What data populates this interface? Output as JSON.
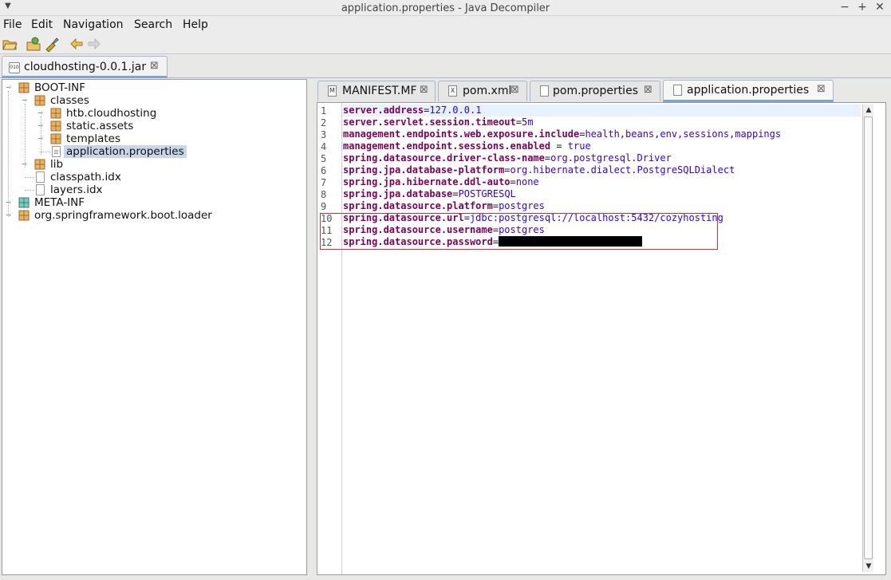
{
  "window": {
    "title": "application.properties - Java Decompiler",
    "minimize": "−",
    "maximize": "+",
    "close": "✕"
  },
  "menu": [
    "File",
    "Edit",
    "Navigation",
    "Search",
    "Help"
  ],
  "jar_tab": {
    "label": "cloudhosting-0.0.1.jar",
    "close": "⊠",
    "icon_text": "010"
  },
  "tree": {
    "nodes": [
      {
        "label": "BOOT-INF"
      },
      {
        "label": "classes"
      },
      {
        "label": "htb.cloudhosting"
      },
      {
        "label": "static.assets"
      },
      {
        "label": "templates"
      },
      {
        "label": "application.properties"
      },
      {
        "label": "lib"
      },
      {
        "label": "classpath.idx"
      },
      {
        "label": "layers.idx"
      },
      {
        "label": "META-INF"
      },
      {
        "label": "org.springframework.boot.loader"
      }
    ]
  },
  "editor_tabs": [
    {
      "label": "MANIFEST.MF",
      "icon": "M"
    },
    {
      "label": "pom.xml",
      "icon": "X"
    },
    {
      "label": "pom.properties",
      "icon": ""
    },
    {
      "label": "application.properties",
      "icon": ""
    }
  ],
  "tab_close": "⊠",
  "code": [
    {
      "n": "1",
      "key": "server.address",
      "sep": "=",
      "val": "127.0.0.1"
    },
    {
      "n": "2",
      "key": "server.servlet.session.timeout",
      "sep": "=",
      "val": "5m"
    },
    {
      "n": "3",
      "key": "management.endpoints.web.exposure.include",
      "sep": "=",
      "val": "health,beans,env,sessions,mappings"
    },
    {
      "n": "4",
      "key": "management.endpoint.sessions.enabled",
      "sep": " = ",
      "val": "true"
    },
    {
      "n": "5",
      "key": "spring.datasource.driver-class-name",
      "sep": "=",
      "val": "org.postgresql.Driver"
    },
    {
      "n": "6",
      "key": "spring.jpa.database-platform",
      "sep": "=",
      "val": "org.hibernate.dialect.PostgreSQLDialect"
    },
    {
      "n": "7",
      "key": "spring.jpa.hibernate.ddl-auto",
      "sep": "=",
      "val": "none"
    },
    {
      "n": "8",
      "key": "spring.jpa.database",
      "sep": "=",
      "val": "POSTGRESQL"
    },
    {
      "n": "9",
      "key": "spring.datasource.platform",
      "sep": "=",
      "val": "postgres"
    },
    {
      "n": "10",
      "key": "spring.datasource.url",
      "sep": "=",
      "val": "jdbc:postgresql://localhost:5432/cozyhosting"
    },
    {
      "n": "11",
      "key": "spring.datasource.username",
      "sep": "=",
      "val": "postgres"
    },
    {
      "n": "12",
      "key": "spring.datasource.password",
      "sep": "=",
      "val": ""
    }
  ],
  "colors": {
    "key": "#7f0055",
    "value": "#2a00ff",
    "highlight": "#d32f2f"
  }
}
